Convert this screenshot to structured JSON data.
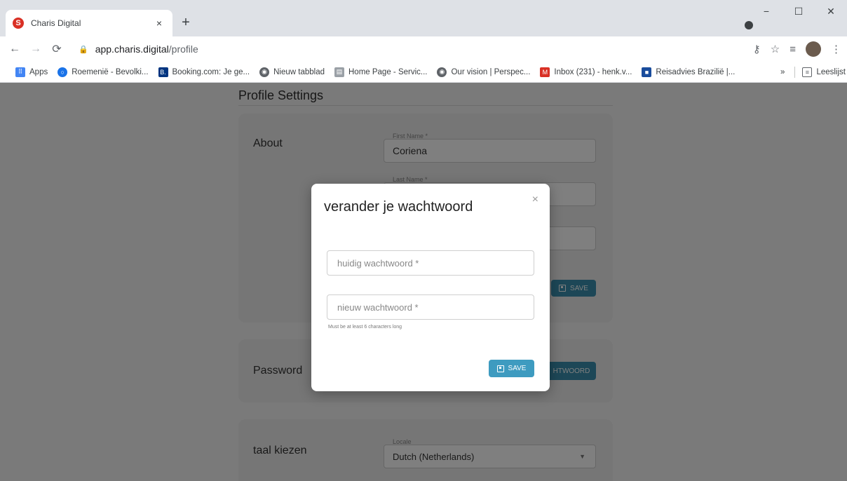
{
  "browser": {
    "tab_title": "Charis Digital",
    "tab_close": "×",
    "new_tab": "+",
    "url_host": "app.charis.digital",
    "url_path": "/profile",
    "minimize": "−",
    "maximize": "☐",
    "close": "✕",
    "bookmarks": [
      {
        "label": "Apps",
        "icon": "apps-grid-icon",
        "color": "#4285f4"
      },
      {
        "label": "Roemenië - Bevolki...",
        "icon": "globe-icon",
        "color": "#1a73e8"
      },
      {
        "label": "Booking.com: Je ge...",
        "icon": "booking-icon",
        "color": "#003580"
      },
      {
        "label": "Nieuw tabblad",
        "icon": "globe-icon",
        "color": "#5f6368"
      },
      {
        "label": "Home Page - Servic...",
        "icon": "page-icon",
        "color": "#9aa0a6"
      },
      {
        "label": "Our vision | Perspec...",
        "icon": "globe-icon",
        "color": "#5f6368"
      },
      {
        "label": "Inbox (231) - henk.v...",
        "icon": "gmail-icon",
        "color": "#d93025"
      },
      {
        "label": "Reisadvies Brazilië |...",
        "icon": "flag-icon",
        "color": "#1a4c9c"
      }
    ],
    "more_bookmarks": "»",
    "reading_list": "Leeslijst"
  },
  "page": {
    "title": "Profile Settings",
    "about": {
      "label": "About",
      "first_name_label": "First Name *",
      "first_name_value": "Coriena",
      "last_name_label": "Last Name *",
      "save_label": "SAVE"
    },
    "password": {
      "label": "Password",
      "button_fragment": "HTWOORD"
    },
    "language": {
      "label": "taal kiezen",
      "locale_label": "Locale",
      "locale_value": "Dutch (Netherlands)"
    }
  },
  "modal": {
    "title": "verander je wachtwoord",
    "close": "×",
    "current_placeholder": "huidig wachtwoord *",
    "new_placeholder": "nieuw wachtwoord *",
    "helper": "Must be at least 6 characters long",
    "save_label": "SAVE"
  },
  "colors": {
    "accent": "#3e9bc0",
    "overlay": "rgba(0,0,0,0.5)"
  }
}
